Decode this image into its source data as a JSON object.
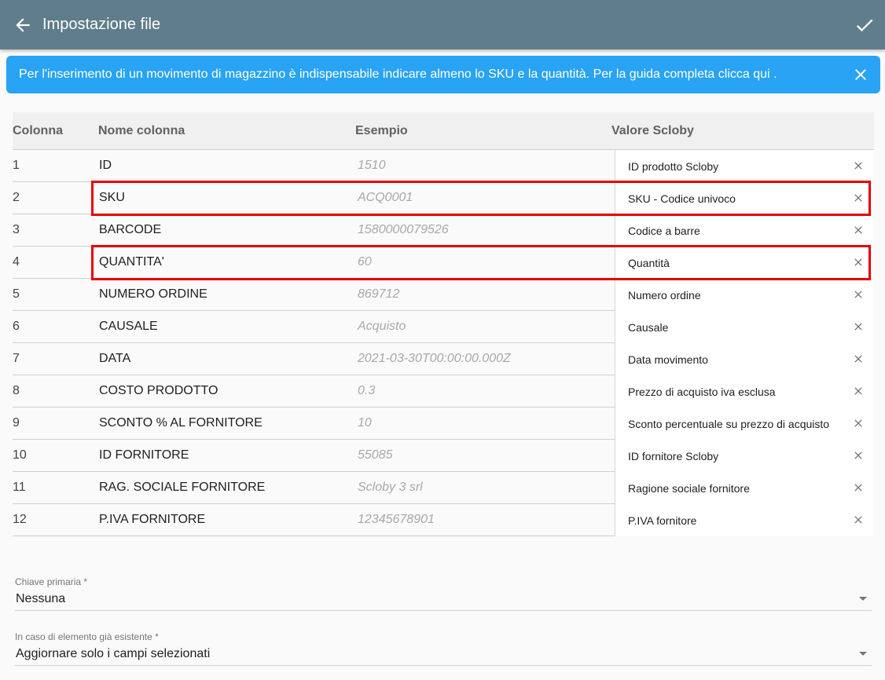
{
  "header": {
    "title": "Impostazione file",
    "back_icon": "arrow-left-icon",
    "confirm_icon": "check-icon",
    "background": "#607d8b"
  },
  "banner": {
    "text": "Per l'inserimento di un movimento di magazzino è indispensabile indicare almeno lo SKU e la quantità. Per la guida completa clicca qui .",
    "close_icon": "close-icon",
    "background": "#29a3f3"
  },
  "table": {
    "headers": {
      "col_number": "Colonna",
      "col_name": "Nome colonna",
      "col_example": "Esempio",
      "col_value": "Valore Scloby"
    },
    "rows": [
      {
        "num": "1",
        "name": "ID",
        "example": "1510",
        "value": "ID prodotto Scloby",
        "highlighted": false
      },
      {
        "num": "2",
        "name": "SKU",
        "example": "ACQ0001",
        "value": "SKU - Codice univoco",
        "highlighted": true
      },
      {
        "num": "3",
        "name": "BARCODE",
        "example": "1580000079526",
        "value": "Codice a barre",
        "highlighted": false
      },
      {
        "num": "4",
        "name": "QUANTITA'",
        "example": "60",
        "value": "Quantità",
        "highlighted": true
      },
      {
        "num": "5",
        "name": "NUMERO ORDINE",
        "example": "869712",
        "value": "Numero ordine",
        "highlighted": false
      },
      {
        "num": "6",
        "name": "CAUSALE",
        "example": "Acquisto",
        "value": "Causale",
        "highlighted": false
      },
      {
        "num": "7",
        "name": "DATA",
        "example": "2021-03-30T00:00:00.000Z",
        "value": "Data movimento",
        "highlighted": false
      },
      {
        "num": "8",
        "name": "COSTO PRODOTTO",
        "example": "0.3",
        "value": "Prezzo di acquisto iva esclusa",
        "highlighted": false
      },
      {
        "num": "9",
        "name": "SCONTO % AL FORNITORE",
        "example": "10",
        "value": "Sconto percentuale su prezzo di acquisto",
        "highlighted": false
      },
      {
        "num": "10",
        "name": "ID FORNITORE",
        "example": "55085",
        "value": "ID fornitore Scloby",
        "highlighted": false
      },
      {
        "num": "11",
        "name": "RAG. SOCIALE FORNITORE",
        "example": "Scloby 3 srl",
        "value": "Ragione sociale fornitore",
        "highlighted": false
      },
      {
        "num": "12",
        "name": "P.IVA FORNITORE",
        "example": "12345678901",
        "value": "P.IVA fornitore",
        "highlighted": false
      }
    ],
    "highlight_color": "#e60000",
    "remove_icon": "close-icon"
  },
  "primary_key": {
    "label": "Chiave primaria *",
    "value": "Nessuna"
  },
  "existing_item": {
    "label": "In caso di elemento già esistente *",
    "value": "Aggiornare solo i campi selezionati"
  }
}
